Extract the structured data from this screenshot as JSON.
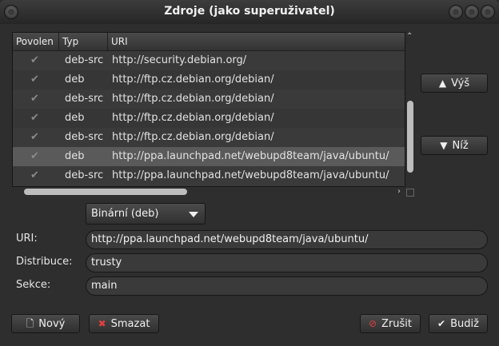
{
  "window": {
    "title": "Zdroje (jako superuživatel)"
  },
  "table": {
    "headers": [
      "Povolen",
      "Typ",
      "URI"
    ],
    "rows": [
      {
        "enabled": true,
        "type": "deb-src",
        "uri": "http://security.debian.org/"
      },
      {
        "enabled": true,
        "type": "deb",
        "uri": "http://ftp.cz.debian.org/debian/"
      },
      {
        "enabled": true,
        "type": "deb-src",
        "uri": "http://ftp.cz.debian.org/debian/"
      },
      {
        "enabled": true,
        "type": "deb",
        "uri": "http://ftp.cz.debian.org/debian/"
      },
      {
        "enabled": true,
        "type": "deb-src",
        "uri": "http://ftp.cz.debian.org/debian/"
      },
      {
        "enabled": true,
        "type": "deb",
        "uri": "http://ppa.launchpad.net/webupd8team/java/ubuntu/",
        "selected": true
      },
      {
        "enabled": true,
        "type": "deb-src",
        "uri": "http://ppa.launchpad.net/webupd8team/java/ubuntu/"
      }
    ]
  },
  "side_buttons": {
    "up": "Výš",
    "down": "Níž"
  },
  "type_combo": {
    "value": "Binární (deb)"
  },
  "form": {
    "uri_label": "URI:",
    "uri_value": "http://ppa.launchpad.net/webupd8team/java/ubuntu/",
    "dist_label": "Distribuce:",
    "dist_value": "trusty",
    "sections_label": "Sekce:",
    "sections_value": "main"
  },
  "bottom_buttons": {
    "new": "Nový",
    "delete": "Smazat",
    "cancel": "Zrušit",
    "ok": "Budiž"
  }
}
